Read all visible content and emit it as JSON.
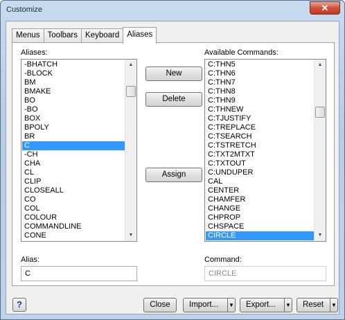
{
  "window": {
    "title": "Customize",
    "close_glyph": "✕"
  },
  "tabs": [
    {
      "label": "Menus"
    },
    {
      "label": "Toolbars"
    },
    {
      "label": "Keyboard"
    },
    {
      "label": "Aliases"
    }
  ],
  "aliases": {
    "label": "Aliases:",
    "items": [
      "-BHATCH",
      "-BLOCK",
      "BM",
      "BMAKE",
      "BO",
      "-BO",
      "BOX",
      "BPOLY",
      "BR",
      "C",
      "-CH",
      "CHA",
      "CL",
      "CLIP",
      "CLOSEALL",
      "CO",
      "COL",
      "COLOUR",
      "COMMANDLINE",
      "CONE"
    ],
    "selected_index": 9
  },
  "commands": {
    "label": "Available Commands:",
    "items": [
      "C:THN5",
      "C:THN6",
      "C:THN7",
      "C:THN8",
      "C:THN9",
      "C:THNEW",
      "C:TJUSTIFY",
      "C:TREPLACE",
      "C:TSEARCH",
      "C:TSTRETCH",
      "C:TXT2MTXT",
      "C:TXTOUT",
      "C:UNDUPER",
      "CAL",
      "CENTER",
      "CHAMFER",
      "CHANGE",
      "CHPROP",
      "CHSPACE",
      "CIRCLE"
    ],
    "selected_index": 19
  },
  "buttons": {
    "new": "New",
    "delete": "Delete",
    "assign": "Assign"
  },
  "alias_field": {
    "label": "Alias:",
    "value": "C"
  },
  "command_field": {
    "label": "Command:",
    "value": "CIRCLE"
  },
  "footer": {
    "help": "?",
    "close": "Close",
    "import": "Import...",
    "export": "Export...",
    "reset": "Reset"
  }
}
